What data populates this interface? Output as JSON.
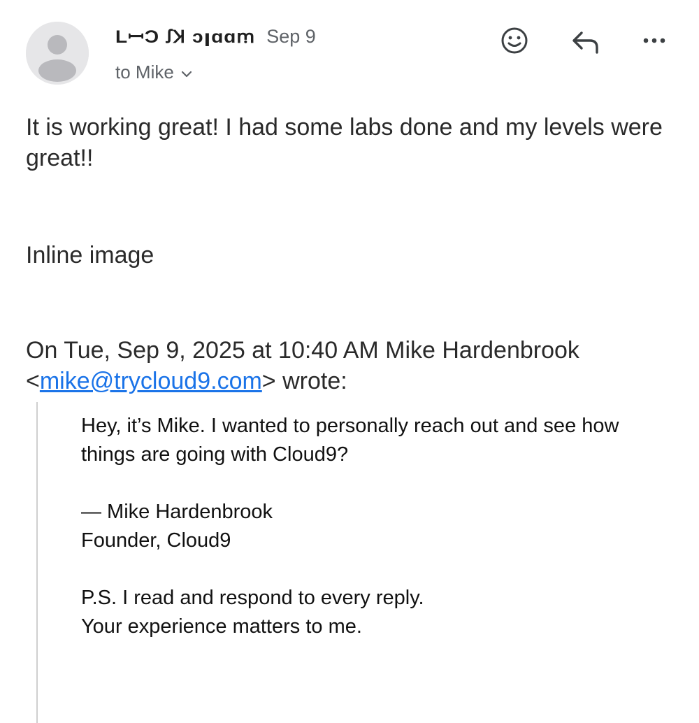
{
  "message": {
    "sender_name": "LꟷƆ ꭍꞰ ɔꞁɑɑꭑ",
    "date": "Sep 9",
    "to_label": "to Mike",
    "body": "It is working great! I had some labs done and my levels were great!!",
    "inline_image_label": "Inline image"
  },
  "actions": {
    "emoji_icon": "emoji-reaction-icon",
    "reply_icon": "reply-icon",
    "more_icon": "more-options-icon"
  },
  "quote": {
    "header_prefix": "On Tue, Sep 9, 2025 at 10:40 AM Mike Hardenbrook",
    "email_open": "<",
    "email": "mike@trycloud9.com",
    "email_close": ">",
    "header_suffix": " wrote:",
    "line1": "Hey, it’s Mike. I wanted to personally reach out and see how things are going with Cloud9?",
    "signature_name": "— Mike Hardenbrook",
    "signature_title": "Founder, Cloud9",
    "ps_line1": "P.S. I read and respond to every reply.",
    "ps_line2": "Your experience matters to me."
  },
  "colors": {
    "link": "#1a73e8",
    "secondary_text": "#5f6368",
    "avatar_bg": "#e6e6e8"
  }
}
